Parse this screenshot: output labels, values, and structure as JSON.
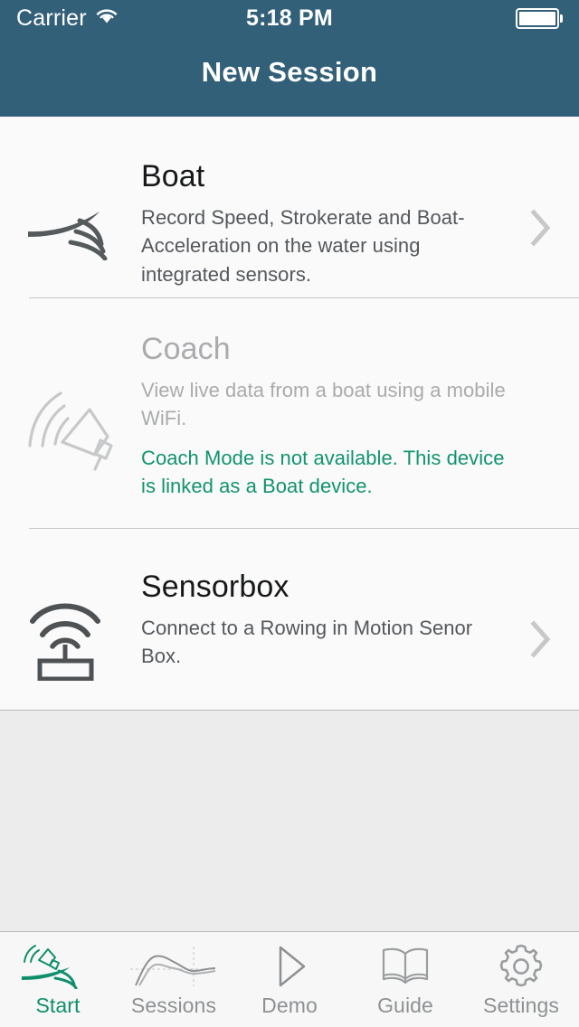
{
  "status_bar": {
    "carrier": "Carrier",
    "wifi_icon": "wifi-icon",
    "time": "5:18 PM",
    "battery_icon": "battery-full-icon"
  },
  "nav": {
    "title": "New Session"
  },
  "colors": {
    "header_bg": "#336079",
    "accent_green": "#11936f",
    "list_bg": "#fafafa",
    "page_bg": "#ececec",
    "title_text": "#16181a",
    "desc_text": "#54585c",
    "disabled_text": "#a9abad",
    "tab_inactive": "#8e9193",
    "tab_active": "#0f8f6c"
  },
  "list": {
    "rows": [
      {
        "id": "boat",
        "icon": "boat-wake-icon",
        "title": "Boat",
        "description": "Record Speed, Strokerate and Boat-Acceleration on the water using integrated sensors.",
        "note": "",
        "disabled": false,
        "chevron": "chevron-right-icon"
      },
      {
        "id": "coach",
        "icon": "megaphone-icon",
        "title": "Coach",
        "description": "View live data from a boat using a mobile WiFi.",
        "note": "Coach Mode is not available. This device is linked as a Boat device.",
        "disabled": true,
        "chevron": ""
      },
      {
        "id": "sensorbox",
        "icon": "antenna-box-icon",
        "title": "Sensorbox",
        "description": "Connect to a Rowing in Motion Senor Box.",
        "note": "",
        "disabled": false,
        "chevron": "chevron-right-icon"
      }
    ]
  },
  "tabbar": {
    "items": [
      {
        "id": "start",
        "label": "Start",
        "icon": "start-megaphone-wake-icon",
        "active": true
      },
      {
        "id": "sessions",
        "label": "Sessions",
        "icon": "line-chart-icon",
        "active": false
      },
      {
        "id": "demo",
        "label": "Demo",
        "icon": "play-triangle-icon",
        "active": false
      },
      {
        "id": "guide",
        "label": "Guide",
        "icon": "open-book-icon",
        "active": false
      },
      {
        "id": "settings",
        "label": "Settings",
        "icon": "gear-icon",
        "active": false
      }
    ]
  }
}
